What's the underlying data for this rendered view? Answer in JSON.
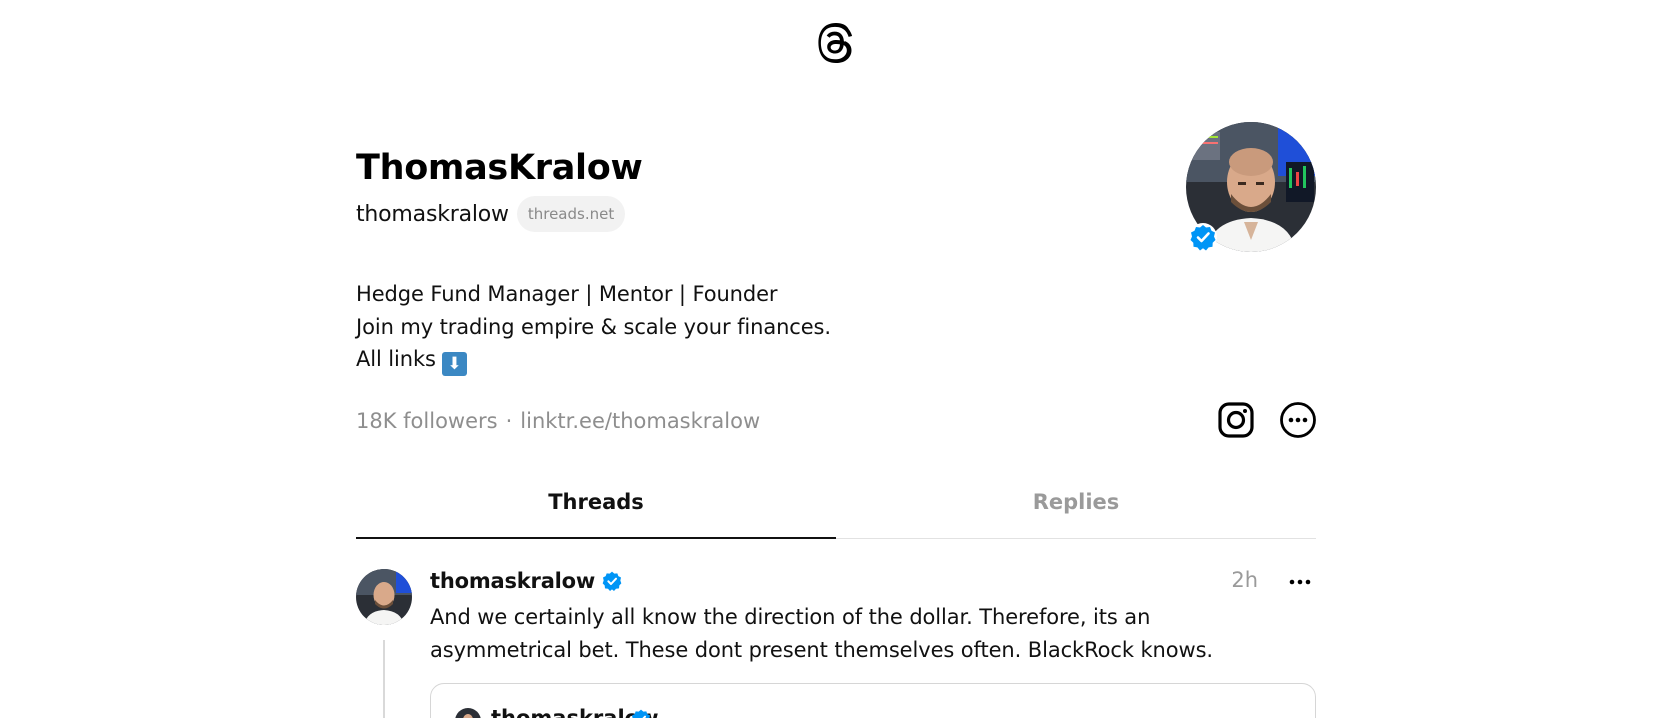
{
  "app": {
    "logo_icon": "threads-logo-icon"
  },
  "profile": {
    "display_name": "ThomasKralow",
    "username": "thomaskralow",
    "domain_badge": "threads.net",
    "verified": true,
    "bio": [
      "Hedge Fund Manager | Mentor | Founder",
      "Join my trading empire & scale your finances.",
      "All links"
    ],
    "bio_emoji": "⬇",
    "followers": "18K followers",
    "separator": "·",
    "link": "linktr.ee/thomaskralow",
    "actions": {
      "instagram_icon": "instagram-icon",
      "more_icon": "more-options-icon"
    }
  },
  "tabs": [
    {
      "label": "Threads",
      "active": true
    },
    {
      "label": "Replies",
      "active": false
    }
  ],
  "post": {
    "username": "thomaskralow",
    "verified": true,
    "time": "2h",
    "text": "And we certainly all know the direction of the dollar. Therefore, its an asymmetrical bet. These dont present themselves often. BlackRock knows.",
    "quoted": {
      "username": "thomaskralow",
      "verified": true
    }
  },
  "colors": {
    "verified_blue": "#0095f6",
    "muted_text": "#8e8e8e",
    "text": "#111111",
    "border": "#e2e2e2"
  }
}
